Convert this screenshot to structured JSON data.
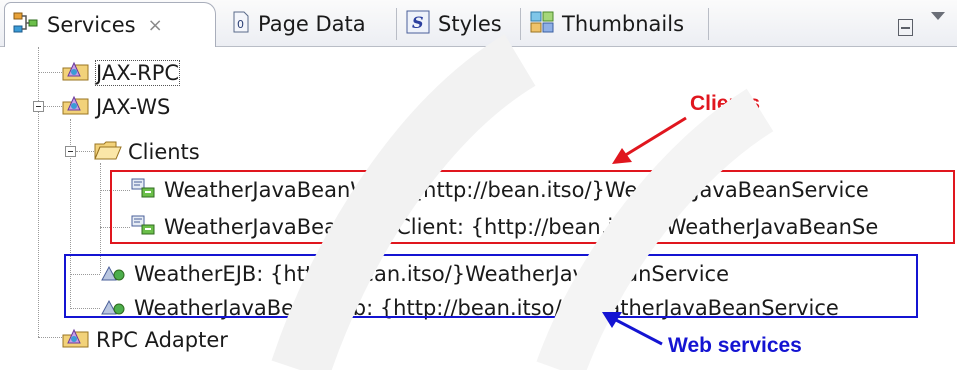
{
  "tabs": [
    {
      "label": "Services",
      "icon": "services-icon",
      "active": true,
      "close": "×"
    },
    {
      "label": "Page Data",
      "icon": "page-data-icon"
    },
    {
      "label": "Styles",
      "icon": "styles-icon"
    },
    {
      "label": "Thumbnails",
      "icon": "thumbnails-icon"
    }
  ],
  "tree": {
    "jax_rpc": "JAX-RPC",
    "jax_ws": "JAX-WS",
    "clients": "Clients",
    "client1": "WeatherJavaBeanWeb: {http://bean.itso/}WeatherJavaBeanService",
    "client2": "WeatherJavaBeanWebClient: {http://bean.itso/}WeatherJavaBeanSe",
    "service1": "WeatherEJB: {http://bean.itso/}WeatherJavaBeanService",
    "service2": "WeatherJavaBeanWeb: {http://bean.itso/}WeatherJavaBeanService",
    "rpc_adapter": "RPC Adapter"
  },
  "annotations": {
    "clients": "Clients",
    "web_services": "Web services"
  },
  "colors": {
    "annotation_red": "#e0161e",
    "annotation_blue": "#1414d2"
  }
}
